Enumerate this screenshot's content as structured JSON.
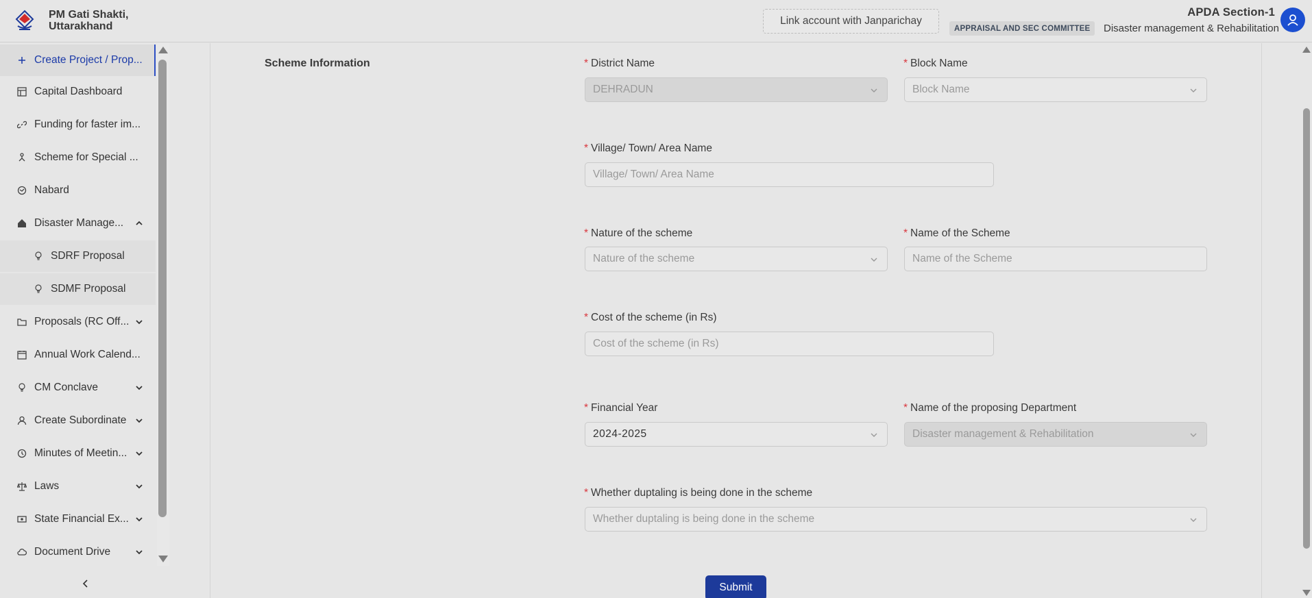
{
  "header": {
    "brand_line1": "PM Gati Shakti,",
    "brand_line2": "Uttarakhand",
    "link_account_label": "Link account with Janparichay",
    "user_name": "APDA Section-1",
    "committee_badge": "APPRAISAL AND SEC COMMITTEE",
    "department": "Disaster management & Rehabilitation"
  },
  "sidebar": {
    "items": [
      {
        "label": "Create Project / Prop...",
        "icon": "plus-icon"
      },
      {
        "label": "Capital Dashboard",
        "icon": "dashboard-icon"
      },
      {
        "label": "Funding for faster im...",
        "icon": "link-icon"
      },
      {
        "label": "Scheme for Special ...",
        "icon": "hierarchy-icon"
      },
      {
        "label": "Nabard",
        "icon": "globe-icon"
      },
      {
        "label": "Disaster Manage...",
        "icon": "home-icon"
      },
      {
        "label": "SDRF Proposal",
        "icon": "bulb-icon"
      },
      {
        "label": "SDMF Proposal",
        "icon": "bulb-icon"
      },
      {
        "label": "Proposals (RC Off...",
        "icon": "folder-icon"
      },
      {
        "label": "Annual Work Calend...",
        "icon": "calendar-icon"
      },
      {
        "label": "CM Conclave",
        "icon": "bulb-icon"
      },
      {
        "label": "Create Subordinate",
        "icon": "user-icon"
      },
      {
        "label": "Minutes of Meetin...",
        "icon": "clock-icon"
      },
      {
        "label": "Laws",
        "icon": "scale-icon"
      },
      {
        "label": "State Financial Ex...",
        "icon": "money-icon"
      },
      {
        "label": "Document Drive",
        "icon": "cloud-icon"
      }
    ]
  },
  "form": {
    "section_title": "Scheme Information",
    "required_mark": "*",
    "district_label": "District Name",
    "district_value": "DEHRADUN",
    "block_label": "Block Name",
    "block_placeholder": "Block Name",
    "village_label": "Village/ Town/ Area Name",
    "village_placeholder": "Village/ Town/ Area Name",
    "nature_label": "Nature of the scheme",
    "nature_placeholder": "Nature of the scheme",
    "scheme_name_label": "Name of the Scheme",
    "scheme_name_placeholder": "Name of the Scheme",
    "cost_label": "Cost of the scheme (in Rs)",
    "cost_placeholder": "Cost of the scheme (in Rs)",
    "fy_label": "Financial Year",
    "fy_value": "2024-2025",
    "dept_label": "Name of the proposing Department",
    "dept_value": "Disaster management & Rehabilitation",
    "duplicating_label": "Whether duptaling is being done in the scheme",
    "duplicating_placeholder": "Whether duptaling is being done in the scheme",
    "submit_label": "Submit"
  },
  "colors": {
    "accent": "#1c4fd0",
    "submit": "#1d3a9a",
    "required": "#d9363e"
  }
}
